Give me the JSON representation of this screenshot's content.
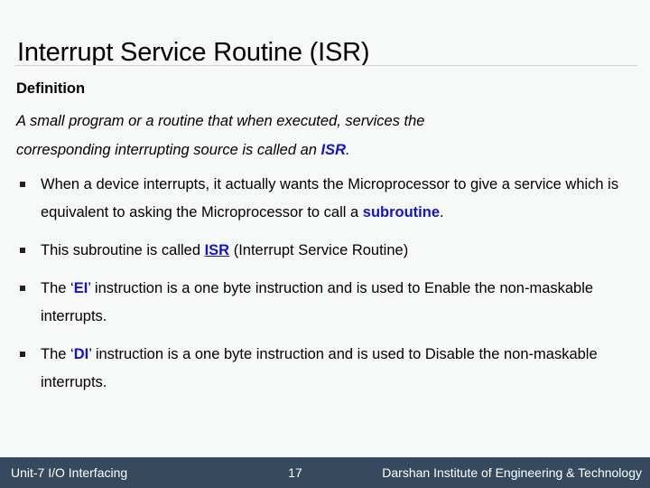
{
  "slide": {
    "title": "Interrupt Service Routine (ISR)",
    "definition_heading": "Definition",
    "definition": {
      "line1": "A small program or a routine that when executed, services the",
      "line2_pre": "corresponding interrupting source is called an ",
      "line2_highlight": "ISR",
      "line2_post": "."
    },
    "bullets": [
      {
        "pre": "When a device interrupts, it actually wants the Microprocessor to give a service which is equivalent to asking the Microprocessor to call a ",
        "highlight": "subroutine",
        "highlight_style": "bold-blue",
        "post": "."
      },
      {
        "pre": "This subroutine is called ",
        "highlight": "ISR",
        "highlight_style": "bold-blue-underline",
        "post": " (Interrupt Service Routine)"
      },
      {
        "pre": "The ‘",
        "highlight": "EI",
        "highlight_style": "bold-blue",
        "post": "’ instruction is a one byte instruction and is used to Enable the non-maskable interrupts."
      },
      {
        "pre": "The ‘",
        "highlight": "DI",
        "highlight_style": "bold-blue",
        "post": "’ instruction is a one byte instruction and is used to Disable the non-maskable interrupts."
      }
    ]
  },
  "footer": {
    "left": "Unit-7 I/O Interfacing",
    "page_number": "17",
    "right": "Darshan Institute of Engineering & Technology"
  },
  "colors": {
    "background": "#f7f8f8",
    "footer_bar": "#36495e",
    "highlight_blue": "#1414c8",
    "rule": "#d4d4d4",
    "text": "#000000",
    "footer_text": "#ffffff"
  }
}
